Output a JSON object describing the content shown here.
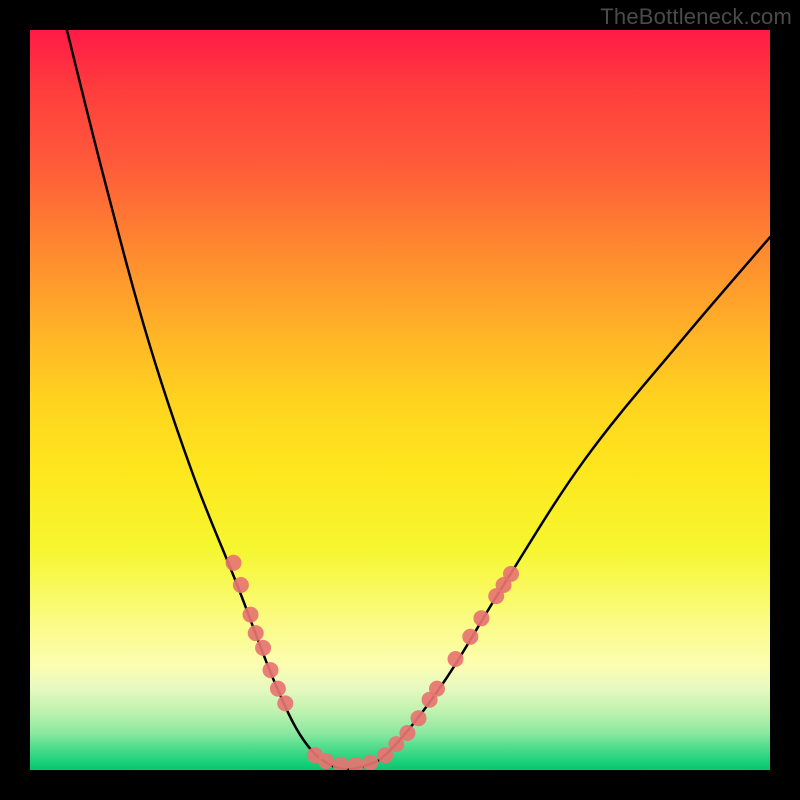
{
  "watermark": "TheBottleneck.com",
  "chart_data": {
    "type": "line",
    "title": "",
    "xlabel": "",
    "ylabel": "",
    "xlim": [
      0,
      100
    ],
    "ylim": [
      0,
      100
    ],
    "grid": false,
    "legend": false,
    "series": [
      {
        "name": "bottleneck-curve",
        "color": "#000000",
        "points": [
          {
            "x": 4,
            "y": 104
          },
          {
            "x": 10,
            "y": 80
          },
          {
            "x": 16,
            "y": 58
          },
          {
            "x": 22,
            "y": 40
          },
          {
            "x": 28,
            "y": 25
          },
          {
            "x": 33,
            "y": 12
          },
          {
            "x": 37,
            "y": 4
          },
          {
            "x": 41,
            "y": 0.5
          },
          {
            "x": 45,
            "y": 0.5
          },
          {
            "x": 49,
            "y": 3
          },
          {
            "x": 56,
            "y": 12
          },
          {
            "x": 64,
            "y": 25
          },
          {
            "x": 75,
            "y": 42
          },
          {
            "x": 88,
            "y": 58
          },
          {
            "x": 100,
            "y": 72
          }
        ]
      },
      {
        "name": "markers",
        "type": "scatter",
        "color": "#e77471",
        "points": [
          {
            "x": 27.5,
            "y": 28
          },
          {
            "x": 28.5,
            "y": 25
          },
          {
            "x": 29.8,
            "y": 21
          },
          {
            "x": 30.5,
            "y": 18.5
          },
          {
            "x": 31.5,
            "y": 16.5
          },
          {
            "x": 32.5,
            "y": 13.5
          },
          {
            "x": 33.5,
            "y": 11
          },
          {
            "x": 34.5,
            "y": 9
          },
          {
            "x": 38.5,
            "y": 2
          },
          {
            "x": 40,
            "y": 1.2
          },
          {
            "x": 42,
            "y": 0.7
          },
          {
            "x": 44,
            "y": 0.7
          },
          {
            "x": 46,
            "y": 1
          },
          {
            "x": 48,
            "y": 2
          },
          {
            "x": 49.5,
            "y": 3.5
          },
          {
            "x": 51,
            "y": 5
          },
          {
            "x": 52.5,
            "y": 7
          },
          {
            "x": 54,
            "y": 9.5
          },
          {
            "x": 55,
            "y": 11
          },
          {
            "x": 57.5,
            "y": 15
          },
          {
            "x": 59.5,
            "y": 18
          },
          {
            "x": 61,
            "y": 20.5
          },
          {
            "x": 63,
            "y": 23.5
          },
          {
            "x": 64,
            "y": 25
          },
          {
            "x": 65,
            "y": 26.5
          }
        ]
      }
    ]
  }
}
